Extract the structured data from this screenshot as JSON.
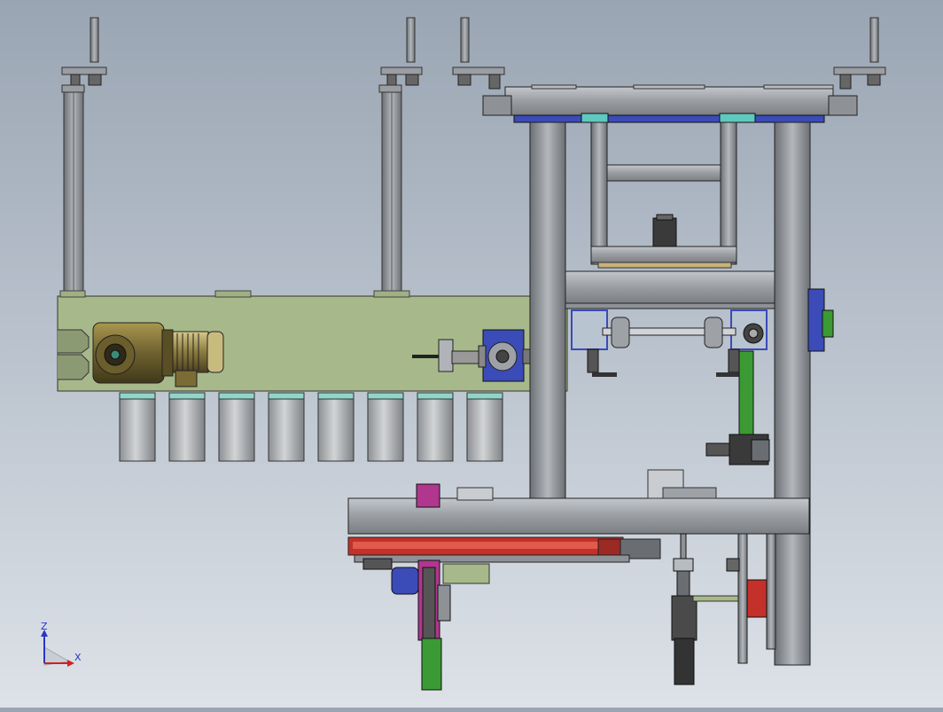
{
  "viewport": {
    "background_top": "#9aa5b3",
    "background_bottom": "#dde2e8"
  },
  "colors": {
    "steel": "#8e9296",
    "steel_light": "#b8bcc0",
    "steel_dark": "#5c6064",
    "base_plate": "#a7b98a",
    "motor_gold": "#8b7a3e",
    "motor_dark": "#3d3a2a",
    "blue_part": "#3b4bb8",
    "cyan_part": "#5fc9c0",
    "green_arm": "#3c9a34",
    "red_rail": "#c4302a",
    "magenta_part": "#b0368e",
    "cup_gray": "#b5b8bb"
  },
  "triad": {
    "z_label": "Z",
    "x_label": "X",
    "z_icon": "axis-z-arrow",
    "x_icon": "axis-x-arrow",
    "origin_icon": "axis-origin-cone"
  }
}
